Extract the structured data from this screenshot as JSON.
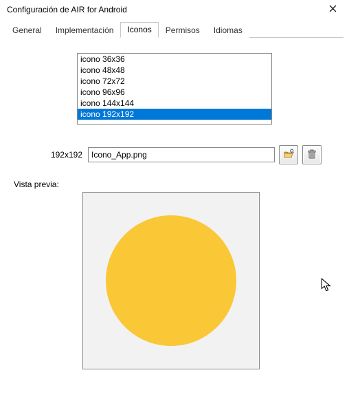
{
  "window": {
    "title": "Configuración de AIR for Android"
  },
  "tabs": {
    "items": [
      {
        "label": "General"
      },
      {
        "label": "Implementación"
      },
      {
        "label": "Iconos"
      },
      {
        "label": "Permisos"
      },
      {
        "label": "Idiomas"
      }
    ],
    "active_index": 2
  },
  "icon_list": {
    "items": [
      {
        "label": "icono 36x36"
      },
      {
        "label": "icono 48x48"
      },
      {
        "label": "icono 72x72"
      },
      {
        "label": "icono 96x96"
      },
      {
        "label": "icono 144x144"
      },
      {
        "label": "icono 192x192"
      }
    ],
    "selected_index": 5
  },
  "size_row": {
    "label": "192x192",
    "path_value": "Icono_App.png"
  },
  "buttons": {
    "browse_icon": "folder-open-icon",
    "delete_icon": "trash-icon"
  },
  "preview": {
    "label": "Vista previa:",
    "shape": "circle",
    "fill": "#fac736",
    "bg": "#f2f2f2"
  }
}
